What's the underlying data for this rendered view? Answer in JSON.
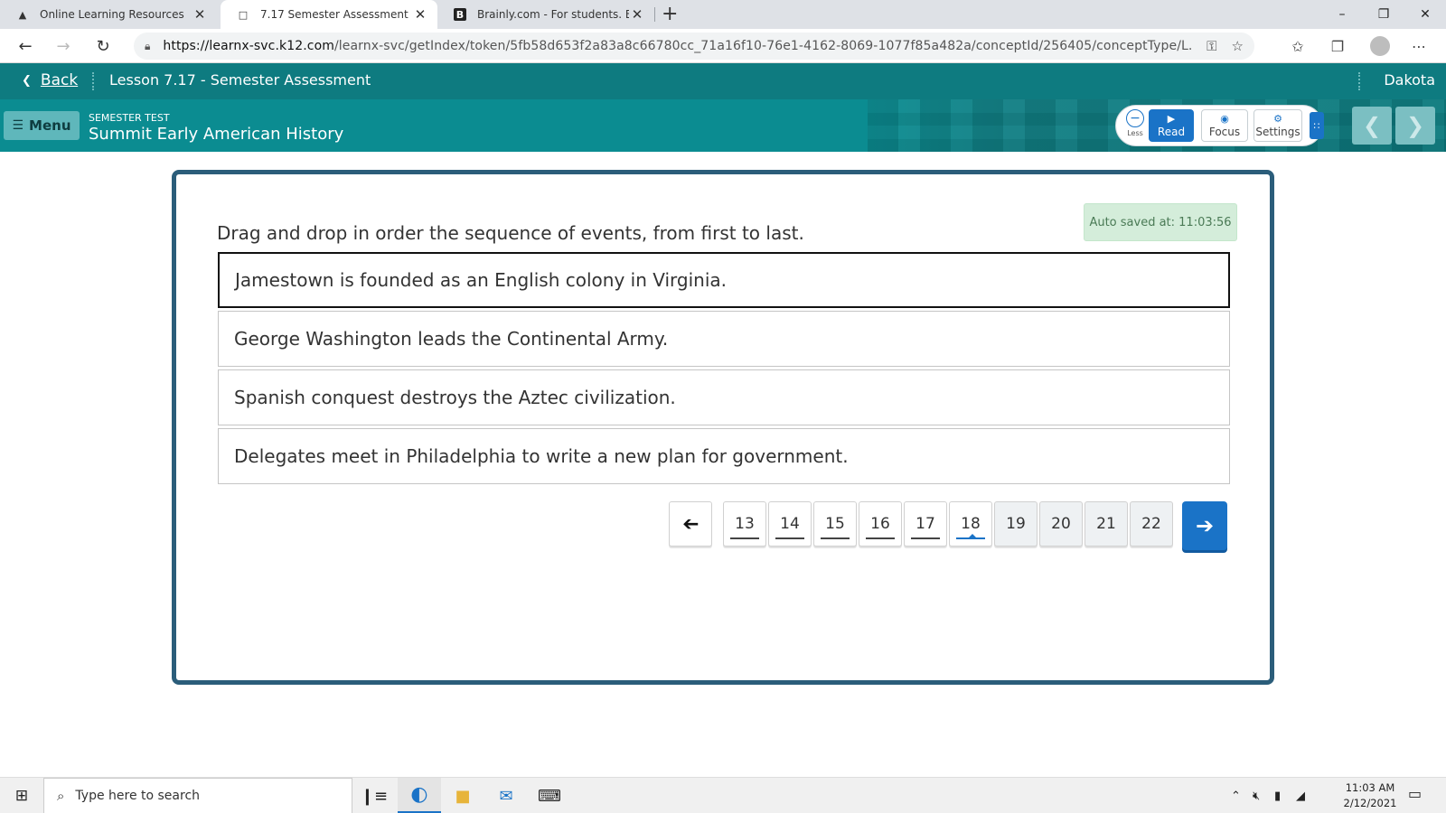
{
  "browser": {
    "tabs": [
      {
        "title": "Online Learning Resources",
        "icon": "tree-icon"
      },
      {
        "title": "7.17 Semester Assessment",
        "icon": "document-icon"
      },
      {
        "title": "Brainly.com - For students. By st",
        "icon": "brainly-icon"
      }
    ],
    "url_host": "https://learnx-svc.k12.com",
    "url_path": "/learnx-svc/getIndex/token/5fb58d653f2a83a8c66780cc_71a16f10-76e1-4162-8069-1077f85a482a/conceptId/256405/conceptType/L..."
  },
  "app": {
    "back_label": "Back",
    "lesson_title": "Lesson 7.17 - Semester Assessment",
    "user_name": "Dakota",
    "menu_label": "Menu",
    "section_kicker": "SEMESTER TEST",
    "course_title": "Summit Early American History",
    "tools": {
      "less_label": "Less",
      "read_label": "Read",
      "focus_label": "Focus",
      "settings_label": "Settings"
    }
  },
  "question": {
    "autosave_text": "Auto saved at: 11:03:56",
    "prompt": "Drag and drop in order the sequence of events, from first to last.",
    "items": [
      "Jamestown is founded as an English colony in Virginia.",
      "George Washington leads the Continental Army.",
      "Spanish conquest destroys the Aztec civilization.",
      "Delegates meet in Philadelphia to write a new plan for government."
    ],
    "selected_item_index": 0,
    "pages": [
      "13",
      "14",
      "15",
      "16",
      "17",
      "18",
      "19",
      "20",
      "21",
      "22"
    ],
    "current_page": "18"
  },
  "taskbar": {
    "search_placeholder": "Type here to search",
    "time": "11:03 AM",
    "date": "2/12/2021"
  },
  "colors": {
    "header_teal": "#0e7b80",
    "subheader_teal": "#0b8c91",
    "accent_blue": "#1a73c7",
    "card_border": "#2b5d7a",
    "autosave_bg": "#d4edda"
  }
}
